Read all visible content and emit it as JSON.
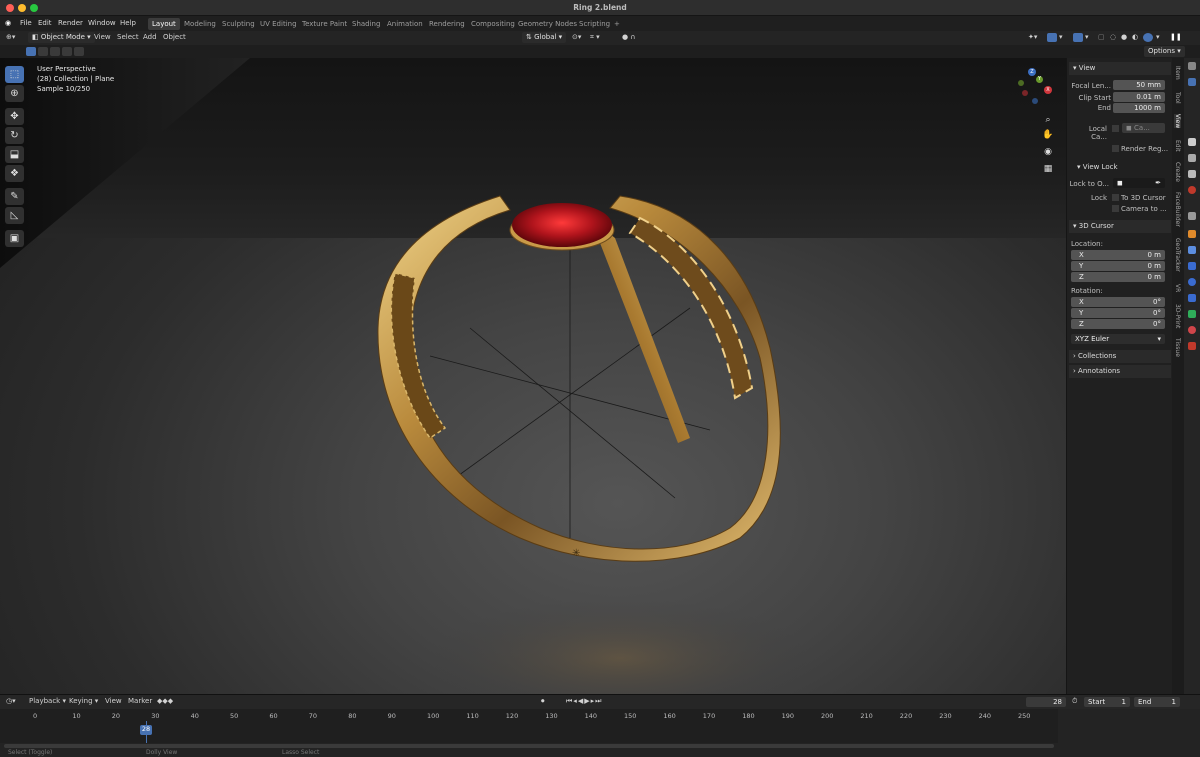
{
  "window": {
    "title": "Ring 2.blend"
  },
  "menu": [
    "File",
    "Edit",
    "Render",
    "Window",
    "Help"
  ],
  "workspaces": [
    "Layout",
    "Modeling",
    "Sculpting",
    "UV Editing",
    "Texture Paint",
    "Shading",
    "Animation",
    "Rendering",
    "Compositing",
    "Geometry Nodes",
    "Scripting",
    "+"
  ],
  "header": {
    "mode": "Object Mode",
    "view": "View",
    "select": "Select",
    "add": "Add",
    "object": "Object",
    "orientation": "Global",
    "options": "Options"
  },
  "overlay": {
    "line1": "User Perspective",
    "line2": "(28) Collection | Plane",
    "line3": "Sample 10/250"
  },
  "gizmo": {
    "x": "X",
    "y": "Y",
    "z": "Z"
  },
  "npanel": {
    "view_header": "View",
    "focal_label": "Focal Len...",
    "focal_value": "50 mm",
    "clip_start_label": "Clip Start",
    "clip_start_value": "0.01 m",
    "end_label": "End",
    "end_value": "1000 m",
    "local_camera_label": "Local Ca...",
    "local_camera_value": "Ca...",
    "render_region": "Render Reg...",
    "view_lock_header": "View Lock",
    "lock_to_label": "Lock to O...",
    "lock_label": "Lock",
    "to_3d_cursor": "To 3D Cursor",
    "camera_to": "Camera to ...",
    "cursor_header": "3D Cursor",
    "location_label": "Location:",
    "loc_x_label": "X",
    "loc_x": "0 m",
    "loc_y_label": "Y",
    "loc_y": "0 m",
    "loc_z_label": "Z",
    "loc_z": "0 m",
    "rotation_label": "Rotation:",
    "rot_x_label": "X",
    "rot_x": "0°",
    "rot_y_label": "Y",
    "rot_y": "0°",
    "rot_z_label": "Z",
    "rot_z": "0°",
    "euler": "XYZ Euler",
    "collections": "Collections",
    "annotations": "Annotations"
  },
  "sidetabs": [
    "Item",
    "Tool",
    "View",
    "Edit",
    "Create",
    "FaceBuilder",
    "GeoTracker",
    "VR",
    "3D-Print",
    "Tissue"
  ],
  "timeline": {
    "playback": "Playback",
    "keying": "Keying",
    "view": "View",
    "marker": "Marker",
    "current_frame": "28",
    "start_label": "Start",
    "start": "1",
    "end_label": "End",
    "end": "1",
    "ticks": [
      "0",
      "10",
      "20",
      "30",
      "40",
      "50",
      "60",
      "70",
      "80",
      "90",
      "100",
      "110",
      "120",
      "130",
      "140",
      "150",
      "160",
      "170",
      "180",
      "190",
      "200",
      "210",
      "220",
      "230",
      "240",
      "250"
    ]
  },
  "status": {
    "select": "Select (Toggle)",
    "dolly": "Dolly View",
    "lasso": "Lasso Select"
  },
  "colors": {
    "accent": "#4772b3",
    "gold": "#c9a35a",
    "ruby": "#b0141c"
  }
}
